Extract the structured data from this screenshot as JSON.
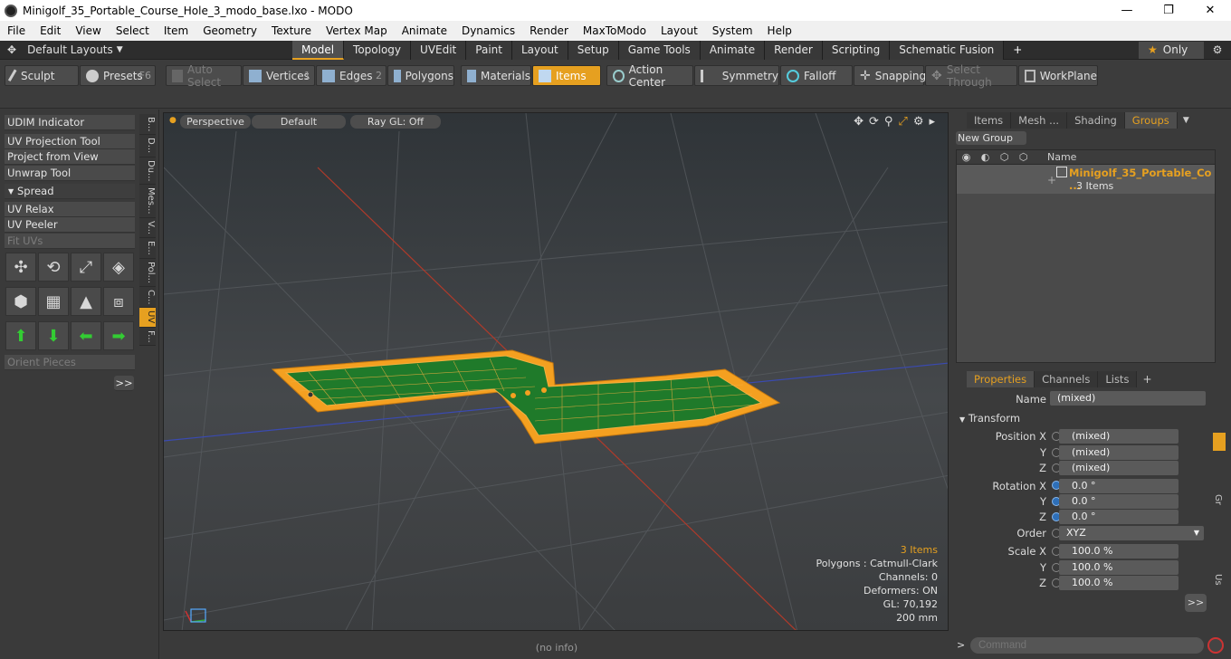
{
  "window": {
    "title": "Minigolf_35_Portable_Course_Hole_3_modo_base.lxo - MODO",
    "controls": [
      "—",
      "❐",
      "✕"
    ]
  },
  "menu": [
    "File",
    "Edit",
    "View",
    "Select",
    "Item",
    "Geometry",
    "Texture",
    "Vertex Map",
    "Animate",
    "Dynamics",
    "Render",
    "MaxToModo",
    "Layout",
    "System",
    "Help"
  ],
  "layoutbar": {
    "layouts_label": "Default Layouts",
    "tabs": [
      "Model",
      "Topology",
      "UVEdit",
      "Paint",
      "Layout",
      "Setup",
      "Game Tools",
      "Animate",
      "Render",
      "Scripting",
      "Schematic Fusion"
    ],
    "active_tab": "Model",
    "plus": "+",
    "only_label": "Only"
  },
  "toolbar": {
    "sculpt": "Sculpt",
    "presets": "Presets",
    "presets_key": "F6",
    "auto_select": "Auto Select",
    "vertices": "Vertices",
    "vertices_num": "1",
    "edges": "Edges",
    "edges_num": "2",
    "polygons": "Polygons",
    "materials": "Materials",
    "items": "Items",
    "action_center": "Action Center",
    "symmetry": "Symmetry",
    "falloff": "Falloff",
    "snapping": "Snapping",
    "select_through": "Select Through",
    "workplane": "WorkPlane"
  },
  "leftpanel": {
    "udim": "UDIM Indicator",
    "uv_projection": "UV Projection Tool",
    "project_from_view": "Project from View",
    "unwrap": "Unwrap Tool",
    "spread": "Spread",
    "uv_relax": "UV Relax",
    "uv_peeler": "UV Peeler",
    "fit_uvs": "Fit UVs",
    "orient_pieces": "Orient Pieces",
    "more": ">>",
    "sidetabs": [
      "B...",
      "D...",
      "Du...",
      "Mes...",
      "V...",
      "E...",
      "Pol...",
      "C...",
      "UV",
      "F..."
    ]
  },
  "viewport": {
    "perspective": "Perspective",
    "default": "Default",
    "raygl": "Ray GL: Off",
    "stats": {
      "items": "3 Items",
      "polygons": "Polygons : Catmull-Clark",
      "channels": "Channels: 0",
      "deformers": "Deformers: ON",
      "gl": "GL: 70,192",
      "size": "200 mm"
    }
  },
  "status": "(no info)",
  "groups": {
    "tabs": [
      "Items",
      "Mesh ...",
      "Shading",
      "Groups"
    ],
    "active_tab": "Groups",
    "new_group": "New Group",
    "col_name": "Name",
    "row_name": "Minigolf_35_Portable_Co ...",
    "row_count": "3 Items"
  },
  "properties": {
    "tabs": [
      "Properties",
      "Channels",
      "Lists"
    ],
    "active_tab": "Properties",
    "name_label": "Name",
    "name_value": "(mixed)",
    "transform": "Transform",
    "position_label": "Position X",
    "rotation_label": "Rotation X",
    "order_label": "Order",
    "scale_label": "Scale X",
    "y": "Y",
    "z": "Z",
    "pos_x": "(mixed)",
    "pos_y": "(mixed)",
    "pos_z": "(mixed)",
    "rot_x": "0.0 °",
    "rot_y": "0.0 °",
    "rot_z": "0.0 °",
    "order": "XYZ",
    "scale_x": "100.0 %",
    "scale_y": "100.0 %",
    "scale_z": "100.0 %",
    "more": ">>",
    "side_gr": "Gr",
    "side_us": "Us"
  },
  "command": {
    "prompt": ">",
    "placeholder": "Command"
  },
  "colors": {
    "accent": "#e6a020",
    "mesh_green": "#1f7a2a",
    "wire_orange": "#f4a020"
  }
}
